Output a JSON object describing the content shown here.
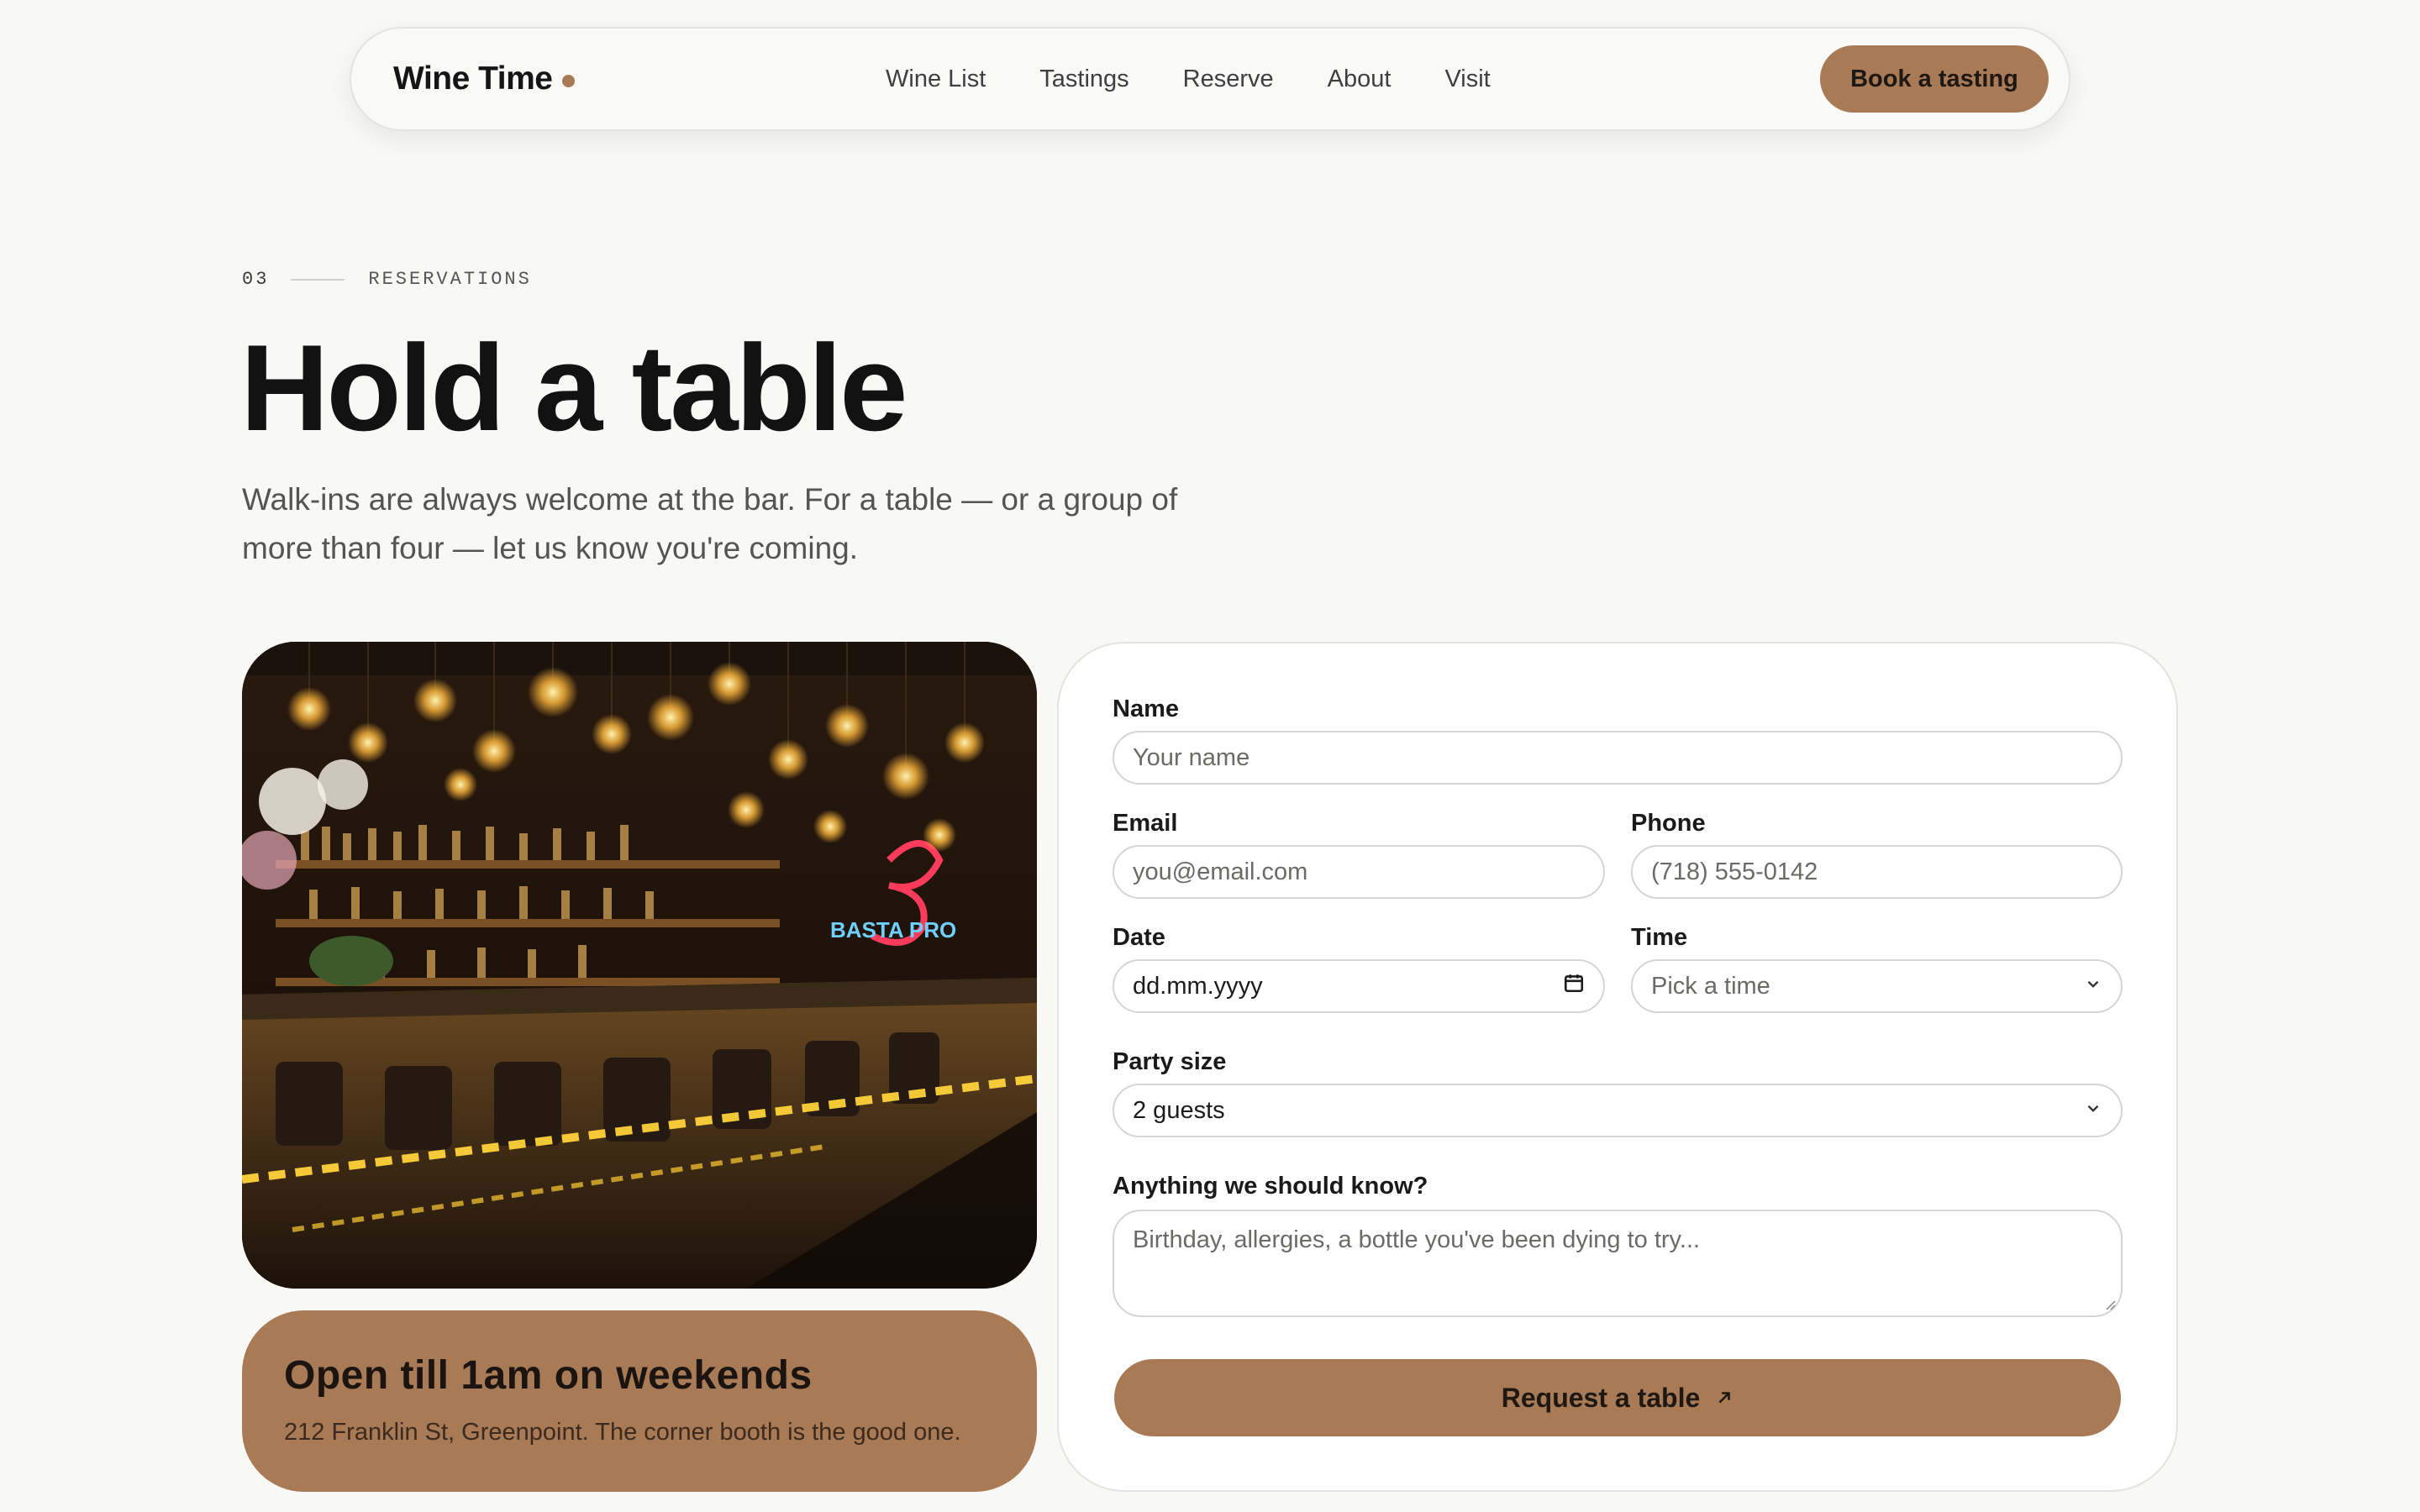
{
  "nav": {
    "brand": "Wine Time",
    "links": [
      "Wine List",
      "Tastings",
      "Reserve",
      "About",
      "Visit"
    ],
    "cta": "Book a tasting"
  },
  "section": {
    "number": "03",
    "label": "RESERVATIONS",
    "title": "Hold a table",
    "subtitle": "Walk-ins are always welcome at the bar. For a table — or a group of more than four — let us know you're coming."
  },
  "hours_card": {
    "title": "Open till 1am on weekends",
    "subtitle": "212 Franklin St, Greenpoint. The corner booth is the good one."
  },
  "form": {
    "name": {
      "label": "Name",
      "placeholder": "Your name"
    },
    "email": {
      "label": "Email",
      "placeholder": "you@email.com"
    },
    "phone": {
      "label": "Phone",
      "placeholder": "(718) 555-0142"
    },
    "date": {
      "label": "Date",
      "value": "dd.mm.yyyy"
    },
    "time": {
      "label": "Time",
      "value": "Pick a time"
    },
    "party": {
      "label": "Party size",
      "value": "2 guests"
    },
    "notes": {
      "label": "Anything we should know?",
      "placeholder": "Birthday, allergies, a bottle you've been dying to try..."
    },
    "submit": "Request a table"
  },
  "icons": {
    "calendar": "calendar-icon",
    "chevron": "chevron-down-icon",
    "arrow": "arrow-up-right-icon"
  },
  "colors": {
    "accent": "#a87a56",
    "background": "#f8f8f6",
    "text": "#121212"
  }
}
